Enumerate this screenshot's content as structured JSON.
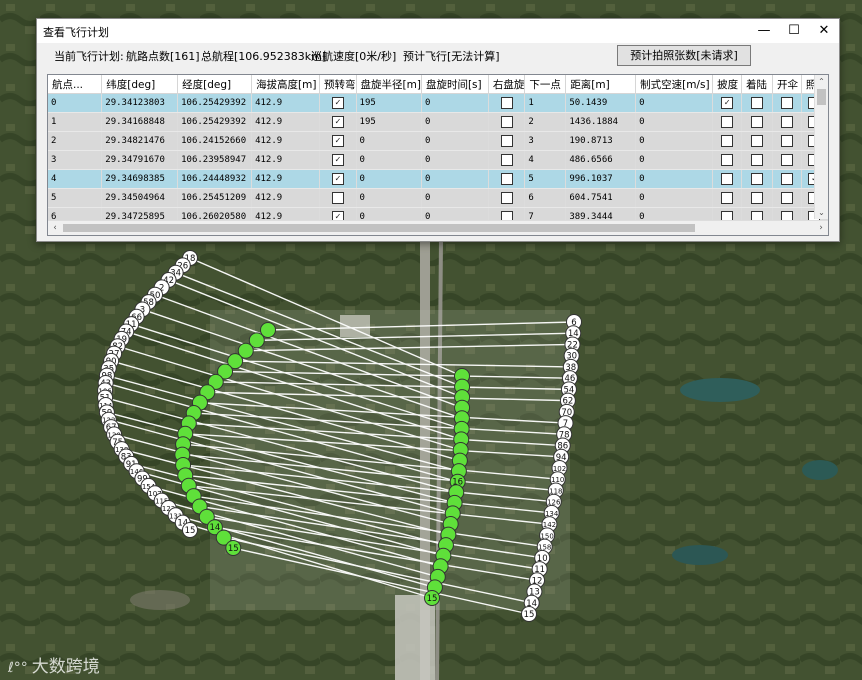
{
  "window": {
    "title": "查看飞行计划",
    "minimize_glyph": "—",
    "maximize_glyph": "☐",
    "close_glyph": "✕"
  },
  "info": {
    "current_plan_label": "当前飞行计划:",
    "waypoint_count": "航路点数[161]",
    "total_range": "总航程[106.952383km]",
    "cruise_speed": "巡航速度[0米/秒]",
    "estimated_flight": "预计飞行[无法计算]",
    "photo_button": "预计拍照张数[未请求]"
  },
  "table": {
    "columns": [
      "航点...",
      "纬度[deg]",
      "经度[deg]",
      "海拔高度[m]",
      "预转弯",
      "盘旋半径[m]",
      "盘旋时间[s]",
      "右盘旋",
      "下一点",
      "距离[m]",
      "制式空速[m/s]",
      "披度",
      "着陆",
      "开伞",
      "照相"
    ],
    "rows": [
      {
        "id": "0",
        "lat": "29.34123803",
        "lon": "106.25429392",
        "alt": "412.9",
        "preturn": true,
        "radius": "195",
        "time": "0",
        "right": false,
        "next": "1",
        "dist": "50.1439",
        "speed": "0",
        "slope": true,
        "land": false,
        "chute": false,
        "photo": false,
        "selected": true
      },
      {
        "id": "1",
        "lat": "29.34168848",
        "lon": "106.25429392",
        "alt": "412.9",
        "preturn": true,
        "radius": "195",
        "time": "0",
        "right": false,
        "next": "2",
        "dist": "1436.1884",
        "speed": "0",
        "slope": false,
        "land": false,
        "chute": false,
        "photo": false,
        "selected": false
      },
      {
        "id": "2",
        "lat": "29.34821476",
        "lon": "106.24152660",
        "alt": "412.9",
        "preturn": true,
        "radius": "0",
        "time": "0",
        "right": false,
        "next": "3",
        "dist": "190.8713",
        "speed": "0",
        "slope": false,
        "land": false,
        "chute": false,
        "photo": false,
        "selected": false
      },
      {
        "id": "3",
        "lat": "29.34791670",
        "lon": "106.23958947",
        "alt": "412.9",
        "preturn": true,
        "radius": "0",
        "time": "0",
        "right": false,
        "next": "4",
        "dist": "486.6566",
        "speed": "0",
        "slope": false,
        "land": false,
        "chute": false,
        "photo": false,
        "selected": false
      },
      {
        "id": "4",
        "lat": "29.34698385",
        "lon": "106.24448932",
        "alt": "412.9",
        "preturn": true,
        "radius": "0",
        "time": "0",
        "right": false,
        "next": "5",
        "dist": "996.1037",
        "speed": "0",
        "slope": false,
        "land": false,
        "chute": false,
        "photo": true,
        "selected": true
      },
      {
        "id": "5",
        "lat": "29.34504964",
        "lon": "106.25451209",
        "alt": "412.9",
        "preturn": false,
        "radius": "0",
        "time": "0",
        "right": false,
        "next": "6",
        "dist": "604.7541",
        "speed": "0",
        "slope": false,
        "land": false,
        "chute": false,
        "photo": false,
        "selected": false
      },
      {
        "id": "6",
        "lat": "29.34725895",
        "lon": "106.26020580",
        "alt": "412.9",
        "preturn": true,
        "radius": "0",
        "time": "0",
        "right": false,
        "next": "7",
        "dist": "389.3444",
        "speed": "0",
        "slope": false,
        "land": false,
        "chute": false,
        "photo": false,
        "selected": false
      }
    ]
  },
  "map": {
    "left_labels": [
      "18",
      "26",
      "34",
      "42",
      "2",
      "50",
      "58",
      "3",
      "66",
      "11",
      "74",
      "19",
      "82",
      "27",
      "90",
      "35",
      "98",
      "43",
      "106",
      "51",
      "114",
      "59",
      "122",
      "67",
      "130",
      "75",
      "138",
      "83",
      "91",
      "146",
      "99",
      "154",
      "107",
      "115",
      "123",
      "131",
      "14",
      "15"
    ],
    "right_labels": [
      "6",
      "14",
      "22",
      "30",
      "38",
      "46",
      "54",
      "62",
      "70",
      "7",
      "78",
      "86",
      "94",
      "102",
      "110",
      "118",
      "126",
      "134",
      "142",
      "150",
      "158",
      "10",
      "11",
      "12",
      "13",
      "14",
      "15"
    ],
    "green_labels": [
      "16",
      "14",
      "15",
      "15"
    ],
    "watermark": "大数跨境",
    "accent_green": "#5fe03a",
    "path_white": "#ffffff"
  }
}
